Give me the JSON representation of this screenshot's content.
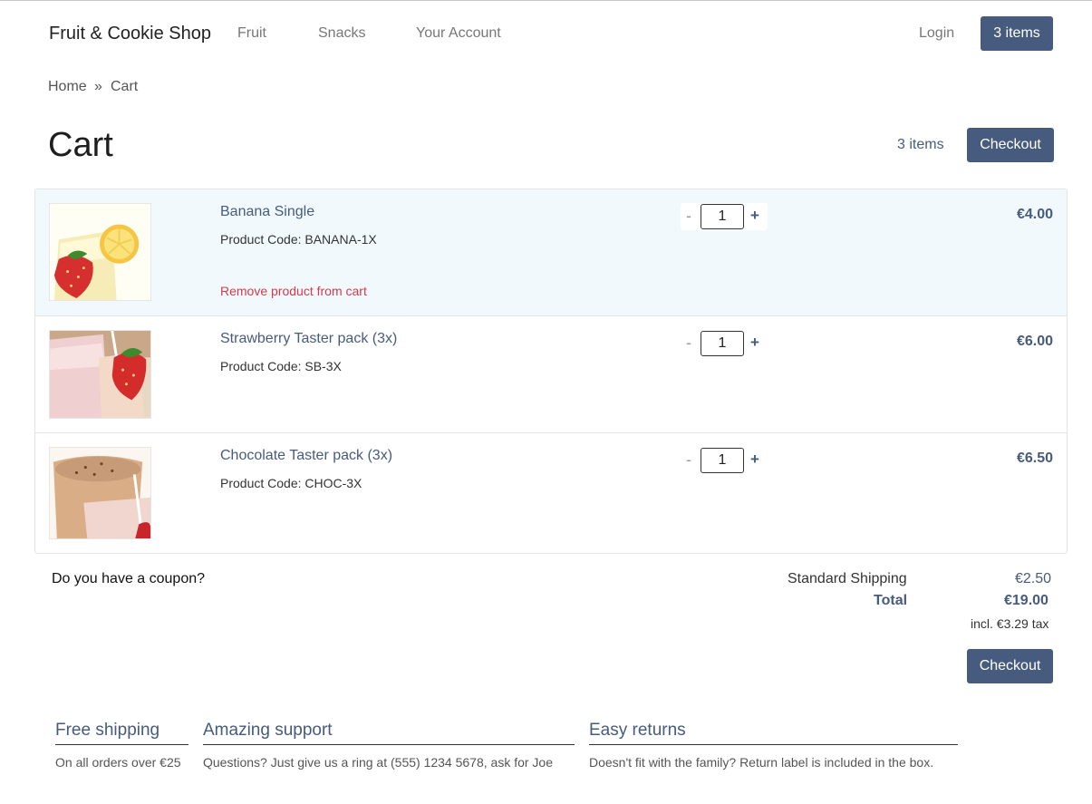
{
  "nav": {
    "brand": "Fruit & Cookie Shop",
    "links": [
      "Fruit",
      "Snacks",
      "Your Account"
    ],
    "login": "Login",
    "cart_button": "3 items"
  },
  "breadcrumb": {
    "home": "Home",
    "separator": "»",
    "current": "Cart"
  },
  "header": {
    "title": "Cart",
    "item_count": "3 items",
    "checkout": "Checkout"
  },
  "cart": {
    "items": [
      {
        "name": "Banana Single",
        "code": "Product Code: BANANA-1X",
        "qty_minus": "-",
        "quantity": "1",
        "qty_plus": "+",
        "price": "€4.00",
        "remove": "Remove product from cart"
      },
      {
        "name": "Strawberry Taster pack (3x)",
        "code": "Product Code: SB-3X",
        "qty_minus": "-",
        "quantity": "1",
        "qty_plus": "+",
        "price": "€6.00"
      },
      {
        "name": "Chocolate Taster pack (3x)",
        "code": "Product Code: CHOC-3X",
        "qty_minus": "-",
        "quantity": "1",
        "qty_plus": "+",
        "price": "€6.50"
      }
    ]
  },
  "summary": {
    "coupon": "Do you have a coupon?",
    "shipping_label": "Standard Shipping",
    "shipping_value": "€2.50",
    "total_label": "Total",
    "total_value": "€19.00",
    "tax_note": "incl. €3.29 tax",
    "checkout": "Checkout"
  },
  "features": [
    {
      "title": "Free shipping",
      "text": "On all orders over €25"
    },
    {
      "title": "Amazing support",
      "text": "Questions? Just give us a ring at (555) 1234 5678, ask for Joe"
    },
    {
      "title": "Easy returns",
      "text": "Doesn't fit with the family? Return label is included in the box."
    }
  ],
  "colors": {
    "accent": "#465b7e",
    "remove": "#d43a4a",
    "highlight_row": "#f2f9fd"
  }
}
